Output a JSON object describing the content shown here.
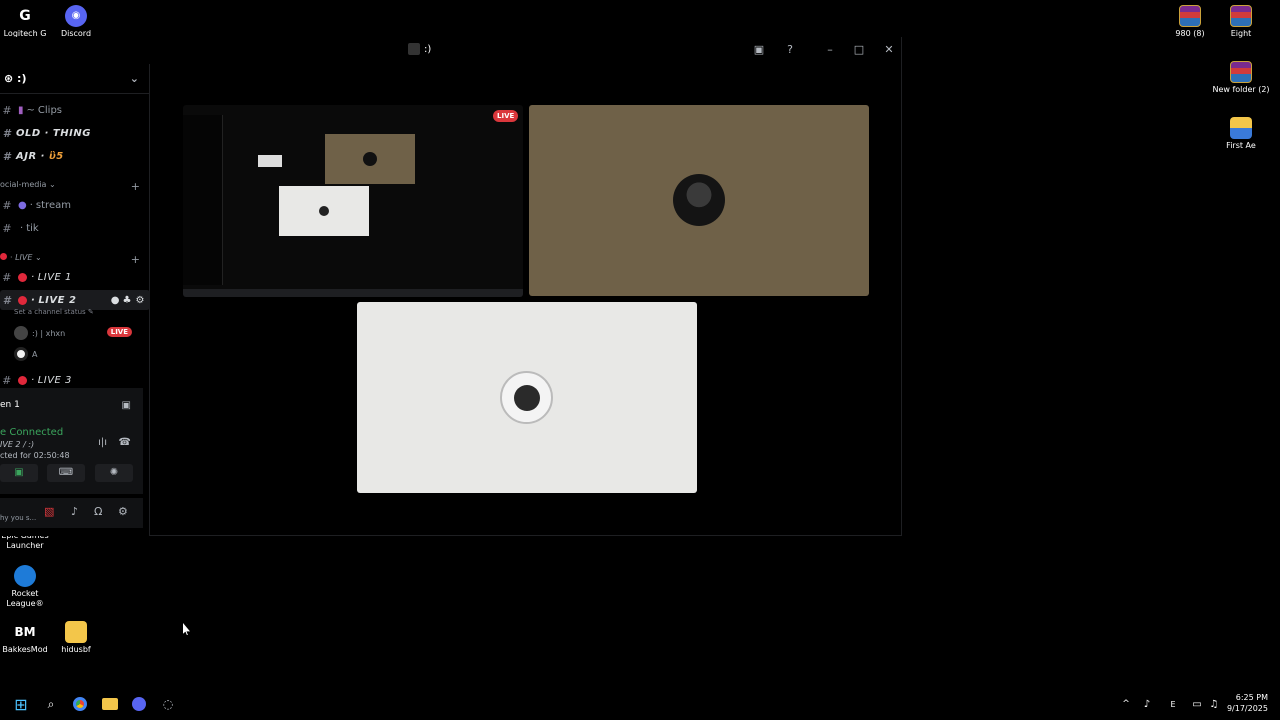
{
  "desktop": {
    "icons_left": [
      {
        "label": "Logitech G"
      },
      {
        "label": "Discord"
      },
      {
        "label": "Epic Games Launcher"
      },
      {
        "label": "Rocket League®"
      },
      {
        "label": "BakkesMod"
      },
      {
        "label": "hidusbf"
      }
    ],
    "icons_right": [
      {
        "label": "980 (8)"
      },
      {
        "label": "Eight"
      },
      {
        "label": "New folder (2)"
      },
      {
        "label": "First Ae"
      }
    ]
  },
  "window": {
    "title": ":)",
    "server_name": ":)",
    "channels": [
      {
        "name": "Clips",
        "prefix": "~"
      },
      {
        "name": "OLD · THING"
      },
      {
        "name": "AJR ·"
      },
      {
        "name": "stream"
      },
      {
        "name": "tik"
      }
    ],
    "categories": {
      "social": "ocial-media",
      "live": "LIVE"
    },
    "live_channels": [
      {
        "name": "LIVE 1"
      },
      {
        "name": "LIVE 2"
      },
      {
        "name": "LIVE 3"
      }
    ],
    "channel_status_hint": "Set a channel status",
    "voice_users": [
      {
        "name": ":) | xhxn",
        "badge": "LIVE"
      },
      {
        "name": "A"
      }
    ],
    "screen_label": "en 1",
    "voice": {
      "status": "e Connected",
      "channel": "IVE 2 / :)",
      "duration": "cted for 02:50:48"
    },
    "user_status": "hy you s..."
  },
  "stream": {
    "live_badge": "LIVE"
  },
  "taskbar": {
    "time": "6:25 PM",
    "date": "9/17/2025"
  }
}
